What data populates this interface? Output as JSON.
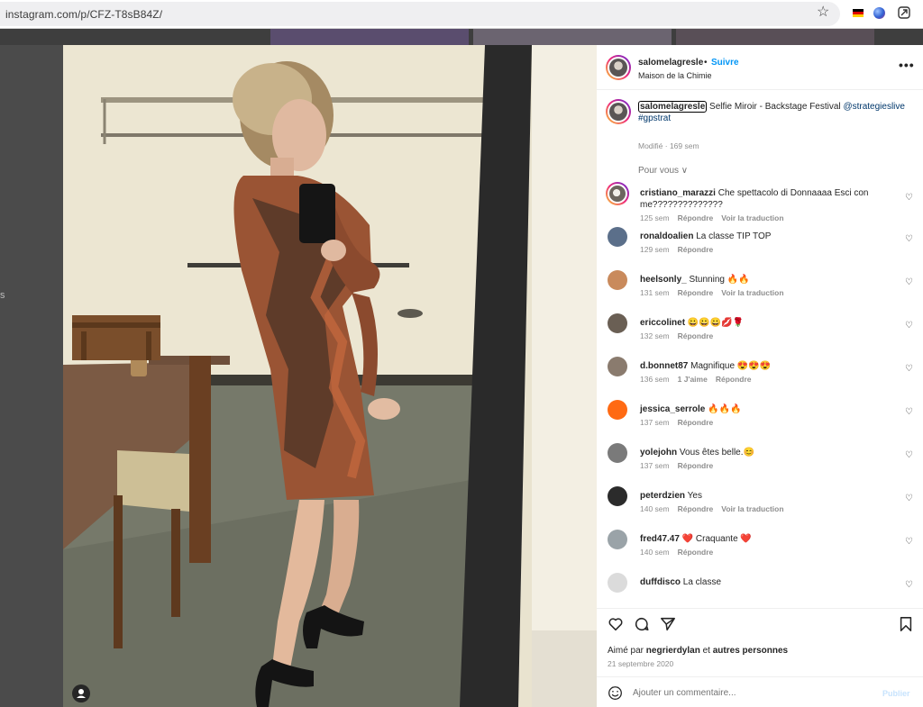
{
  "browser": {
    "url": "instagram.com/p/CFZ-T8sB84Z/",
    "icons": [
      "star-icon",
      "flag-de-icon",
      "globe-extension-icon",
      "send-extension-icon"
    ]
  },
  "side": {
    "text": "s"
  },
  "post": {
    "username": "salomelagresle",
    "dot": "•",
    "follow": "Suivre",
    "location": "Maison de la Chimie",
    "more": "•••"
  },
  "caption": {
    "user": "salomelagresle",
    "text": "Selfie Miroir - Backstage Festival",
    "mention": "@strategieslive",
    "hashtag": "#gpstrat",
    "modified": "Modifié · 169 sem"
  },
  "for_you": "Pour vous ∨",
  "comments": [
    {
      "user": "cristiano_marazzi",
      "text": "Che spettacolo di Donnaaaa Esci con me??????????????",
      "time": "125 sem",
      "likes": "",
      "reply": "Répondre",
      "translate": "Voir la traduction",
      "avatar_color": "ring"
    },
    {
      "user": "ronaldoalien",
      "text": "La classe TIP TOP",
      "time": "129 sem",
      "likes": "",
      "reply": "Répondre",
      "translate": "",
      "avatar_color": "#5b6f8a"
    },
    {
      "user": "heelsonly_",
      "text": "Stunning 🔥🔥",
      "time": "131 sem",
      "likes": "",
      "reply": "Répondre",
      "translate": "Voir la traduction",
      "avatar_color": "#c98a5c"
    },
    {
      "user": "ericcolinet",
      "text": "😀😀😀💋🌹",
      "time": "132 sem",
      "likes": "",
      "reply": "Répondre",
      "translate": "",
      "avatar_color": "#6a5f54"
    },
    {
      "user": "d.bonnet87",
      "text": "Magnifique 😍😍😍",
      "time": "136 sem",
      "likes": "1 J'aime",
      "reply": "Répondre",
      "translate": "",
      "avatar_color": "#8a7b6e"
    },
    {
      "user": "jessica_serrole",
      "text": "🔥🔥🔥",
      "time": "137 sem",
      "likes": "",
      "reply": "Répondre",
      "translate": "",
      "avatar_color": "#ff6a13"
    },
    {
      "user": "yolejohn",
      "text": "Vous êtes belle.😊",
      "time": "137 sem",
      "likes": "",
      "reply": "Répondre",
      "translate": "",
      "avatar_color": "#7a7a7a"
    },
    {
      "user": "peterdzien",
      "text": "Yes",
      "time": "140 sem",
      "likes": "",
      "reply": "Répondre",
      "translate": "Voir la traduction",
      "avatar_color": "#2b2b2b"
    },
    {
      "user": "fred47.47",
      "text": "❤️ Craquante ❤️",
      "time": "140 sem",
      "likes": "",
      "reply": "Répondre",
      "translate": "",
      "avatar_color": "#9aa3a8"
    },
    {
      "user": "duffdisco",
      "text": "La classe",
      "time": "",
      "likes": "",
      "reply": "",
      "translate": "",
      "avatar_color": "#dbdbdb"
    }
  ],
  "actions": {
    "liked_prefix": "Aimé par",
    "liked_user": "negrierdylan",
    "liked_and": "et",
    "liked_others": "autres personnes",
    "date": "21 septembre 2020"
  },
  "add_comment": {
    "placeholder": "Ajouter un commentaire...",
    "publish": "Publier"
  }
}
